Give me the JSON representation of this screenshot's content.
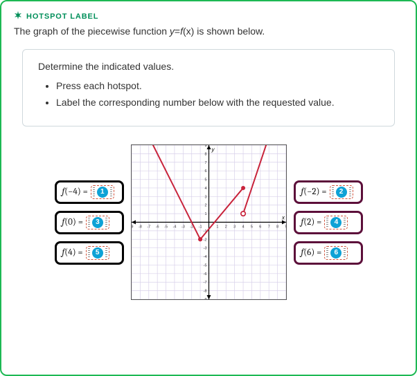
{
  "header": {
    "kicker": "HOTSPOT LABEL"
  },
  "prompt": {
    "prefix": "The graph of the piecewise function ",
    "math_lhs": "y",
    "math_eq": "=",
    "math_f": "f",
    "math_x": "(x)",
    "suffix": " is shown below."
  },
  "instructions": {
    "title": "Determine the indicated values.",
    "bullets": [
      "Press each hotspot.",
      "Label the corresponding number below with the requested value."
    ]
  },
  "left_hotspots": [
    {
      "label_f": "f",
      "label_arg": "(−4)",
      "label_eq": " = ",
      "badge": "1"
    },
    {
      "label_f": "f",
      "label_arg": "(0)",
      "label_eq": " = ",
      "badge": "3"
    },
    {
      "label_f": "f",
      "label_arg": "(4)",
      "label_eq": " = ",
      "badge": "5"
    }
  ],
  "right_hotspots": [
    {
      "label_f": "f",
      "label_arg": "(−2)",
      "label_eq": " = ",
      "badge": "2"
    },
    {
      "label_f": "f",
      "label_arg": "(2)",
      "label_eq": " = ",
      "badge": "4"
    },
    {
      "label_f": "f",
      "label_arg": "(6)",
      "label_eq": " = ",
      "badge": "6"
    }
  ],
  "chart_data": {
    "type": "line",
    "title": "",
    "xlabel": "x",
    "ylabel": "y",
    "xlim": [
      -9,
      9
    ],
    "ylim": [
      -9,
      9
    ],
    "x_ticks": [
      -9,
      -8,
      -7,
      -6,
      -5,
      -4,
      -3,
      -2,
      -1,
      1,
      2,
      3,
      4,
      5,
      6,
      7,
      8,
      9
    ],
    "y_ticks": [
      -9,
      -8,
      -7,
      -6,
      -5,
      -4,
      -3,
      -2,
      -1,
      1,
      2,
      3,
      4,
      5,
      6,
      7,
      8,
      9
    ],
    "series": [
      {
        "name": "piece-1-left-ray",
        "x": [
          -8,
          -1
        ],
        "y": [
          12,
          -2
        ],
        "style": "solid",
        "arrow_start": true,
        "endpoint_end": "closed"
      },
      {
        "name": "piece-2-middle-segment",
        "x": [
          -1,
          4
        ],
        "y": [
          -2,
          4
        ],
        "style": "solid",
        "endpoint_start": "closed",
        "endpoint_end": "closed"
      },
      {
        "name": "piece-2-gap-open",
        "x": [
          4
        ],
        "y": [
          1
        ],
        "style": "point",
        "endpoint": "open"
      },
      {
        "name": "piece-3-right-ray",
        "x": [
          4,
          7
        ],
        "y": [
          1,
          10
        ],
        "style": "solid",
        "endpoint_start": "open",
        "arrow_end": true
      }
    ],
    "implied_values": {
      "f(-4)": 4,
      "f(-2)": 0,
      "f(0)": -1,
      "f(2)": 1,
      "f(4)": 4,
      "f(6)": 7
    }
  },
  "colors": {
    "accent": "#008f5a",
    "border": "#1db954",
    "graph_line": "#c8233b",
    "badge_bg": "#0ea2d6",
    "right_item_border": "#5c0f3a",
    "slot_border": "#d1533c"
  }
}
